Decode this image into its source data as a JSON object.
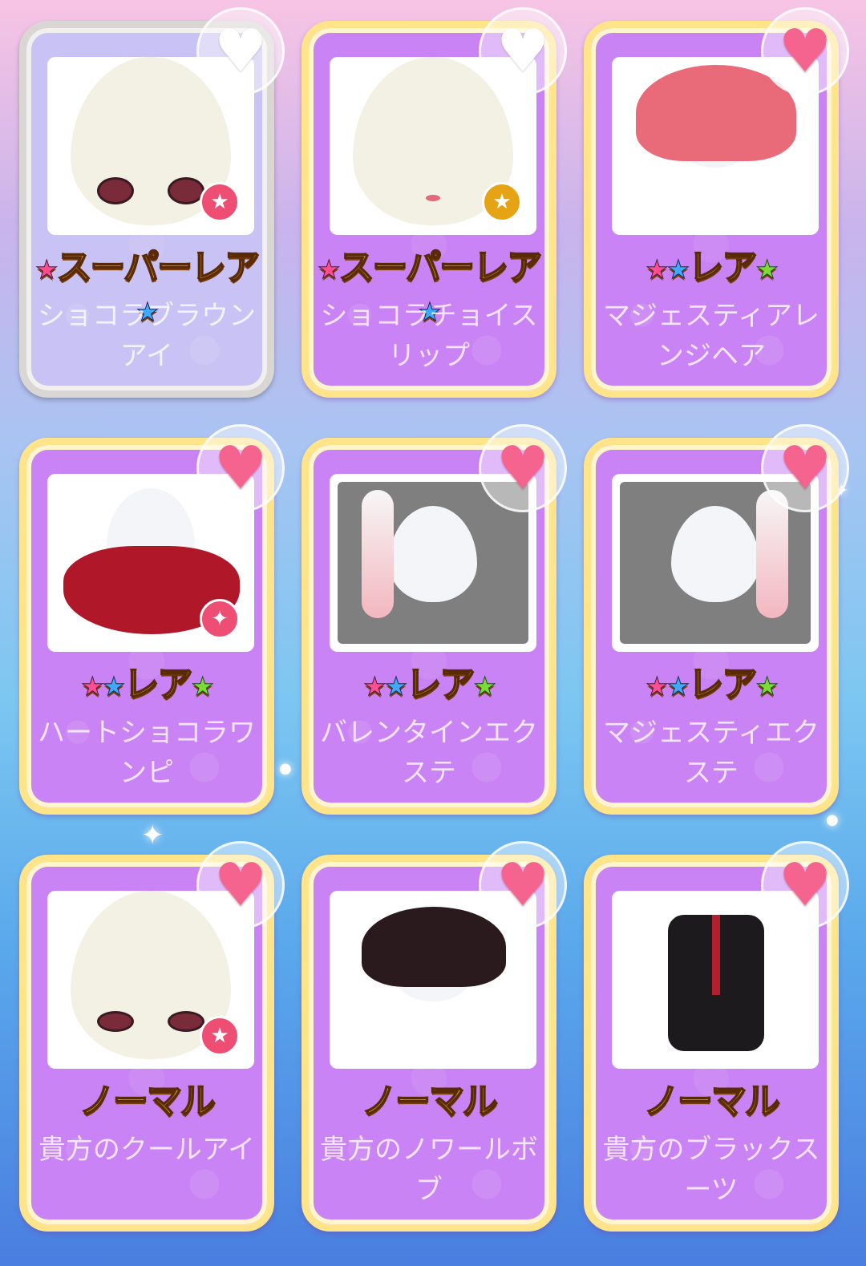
{
  "items": [
    {
      "rarity": "スーパーレア",
      "name": "ショコラブラウンアイ",
      "liked": false,
      "selected": true,
      "badge": "star",
      "badge_color": "#ee4e74"
    },
    {
      "rarity": "スーパーレア",
      "name": "ショコラチョイスリップ",
      "liked": false,
      "selected": false,
      "badge": "star",
      "badge_color": "#e6a414"
    },
    {
      "rarity": "レア",
      "name": "マジェスティアレンジヘア",
      "liked": true,
      "selected": false,
      "badge": "",
      "badge_color": ""
    },
    {
      "rarity": "レア",
      "name": "ハートショコラワンピ",
      "liked": true,
      "selected": false,
      "badge": "sparkle",
      "badge_color": "#ee4e74"
    },
    {
      "rarity": "レア",
      "name": "バレンタインエクステ",
      "liked": true,
      "selected": false,
      "badge": "",
      "badge_color": ""
    },
    {
      "rarity": "レア",
      "name": "マジェスティエクステ",
      "liked": true,
      "selected": false,
      "badge": "",
      "badge_color": ""
    },
    {
      "rarity": "ノーマル",
      "name": "貴方のクールアイ",
      "liked": true,
      "selected": false,
      "badge": "star",
      "badge_color": "#ee4e74"
    },
    {
      "rarity": "ノーマル",
      "name": "貴方のノワールボブ",
      "liked": true,
      "selected": false,
      "badge": "",
      "badge_color": ""
    },
    {
      "rarity": "ノーマル",
      "name": "貴方のブラックスーツ",
      "liked": true,
      "selected": false,
      "badge": "",
      "badge_color": ""
    }
  ],
  "colors": {
    "heart_active": "#f5648f",
    "card_bg": "#c983f4",
    "card_border": "#ffe48a"
  }
}
